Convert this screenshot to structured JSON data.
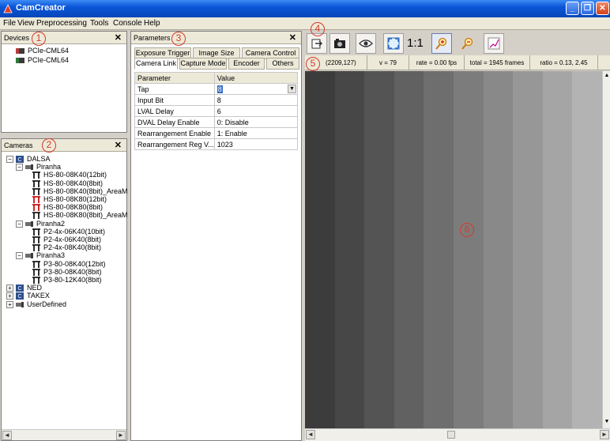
{
  "window": {
    "title": "CamCreator"
  },
  "menu": [
    "File",
    "View",
    "Preprocessing",
    "Tools",
    "Console",
    "Help"
  ],
  "devices_panel": {
    "title": "Devices",
    "callout": "1",
    "items": [
      "PCIe-CML64",
      "PCIe-CML64"
    ]
  },
  "cameras_panel": {
    "title": "Cameras",
    "callout": "2",
    "tree": [
      {
        "label": "DALSA",
        "level": 0,
        "type": "vendor",
        "exp": "-"
      },
      {
        "label": "Piranha",
        "level": 1,
        "type": "family",
        "exp": "-"
      },
      {
        "label": "HS-80-08K40(12bit)",
        "level": 2,
        "type": "camera"
      },
      {
        "label": "HS-80-08K40(8bit)",
        "level": 2,
        "type": "camera"
      },
      {
        "label": "HS-80-08K40(8bit)_AreaM",
        "level": 2,
        "type": "camera"
      },
      {
        "label": "HS-80-08K80(12bit)",
        "level": 2,
        "type": "camera-red"
      },
      {
        "label": "HS-80-08K80(8bit)",
        "level": 2,
        "type": "camera-red"
      },
      {
        "label": "HS-80-08K80(8bit)_AreaM",
        "level": 2,
        "type": "camera"
      },
      {
        "label": "Piranha2",
        "level": 1,
        "type": "family",
        "exp": "-"
      },
      {
        "label": "P2-4x-06K40(10bit)",
        "level": 2,
        "type": "camera"
      },
      {
        "label": "P2-4x-06K40(8bit)",
        "level": 2,
        "type": "camera"
      },
      {
        "label": "P2-4x-08K40(8bit)",
        "level": 2,
        "type": "camera"
      },
      {
        "label": "Piranha3",
        "level": 1,
        "type": "family",
        "exp": "-"
      },
      {
        "label": "P3-80-08K40(12bit)",
        "level": 2,
        "type": "camera"
      },
      {
        "label": "P3-80-08K40(8bit)",
        "level": 2,
        "type": "camera"
      },
      {
        "label": "P3-80-12K40(8bit)",
        "level": 2,
        "type": "camera"
      },
      {
        "label": "NED",
        "level": 0,
        "type": "vendor",
        "exp": "+"
      },
      {
        "label": "TAKEX",
        "level": 0,
        "type": "vendor",
        "exp": "+"
      },
      {
        "label": "UserDefined",
        "level": 0,
        "type": "family",
        "exp": "+"
      }
    ]
  },
  "parameters_panel": {
    "title": "Parameters",
    "callout": "3",
    "tabs_row1": [
      "Exposure Trigger",
      "Image Size",
      "Camera Control"
    ],
    "tabs_row2": [
      "Camera Link",
      "Capture Mode",
      "Encoder",
      "Others"
    ],
    "active_tab": "Camera Link",
    "columns": [
      "Parameter",
      "Value"
    ],
    "rows": [
      {
        "param": "Tap",
        "value": "8"
      },
      {
        "param": "Input Bit",
        "value": "8"
      },
      {
        "param": "LVAL Delay",
        "value": "6"
      },
      {
        "param": "DVAL Delay Enable",
        "value": "0: Disable"
      },
      {
        "param": "Rearrangement Enable",
        "value": "1: Enable"
      },
      {
        "param": "Rearrangement Reg V...",
        "value": "1023"
      }
    ]
  },
  "toolbar": {
    "callout": "4",
    "zoom_label": "1:1"
  },
  "status": {
    "callout": "5",
    "coords": "(2209,127)",
    "v": "v = 79",
    "rate": "rate = 0.00 fps",
    "total": "total = 1945 frames",
    "ratio": "ratio = 0.13, 2.45"
  },
  "image_view": {
    "callout": "6",
    "stripes": [
      "#3c3c3c",
      "#474747",
      "#545454",
      "#616161",
      "#6e6e6e",
      "#7c7c7c",
      "#898989",
      "#979797",
      "#a5a5a5",
      "#b3b3b3"
    ]
  },
  "colors": {
    "titlebar": "#0a55d8",
    "callout": "#d63a2a"
  }
}
